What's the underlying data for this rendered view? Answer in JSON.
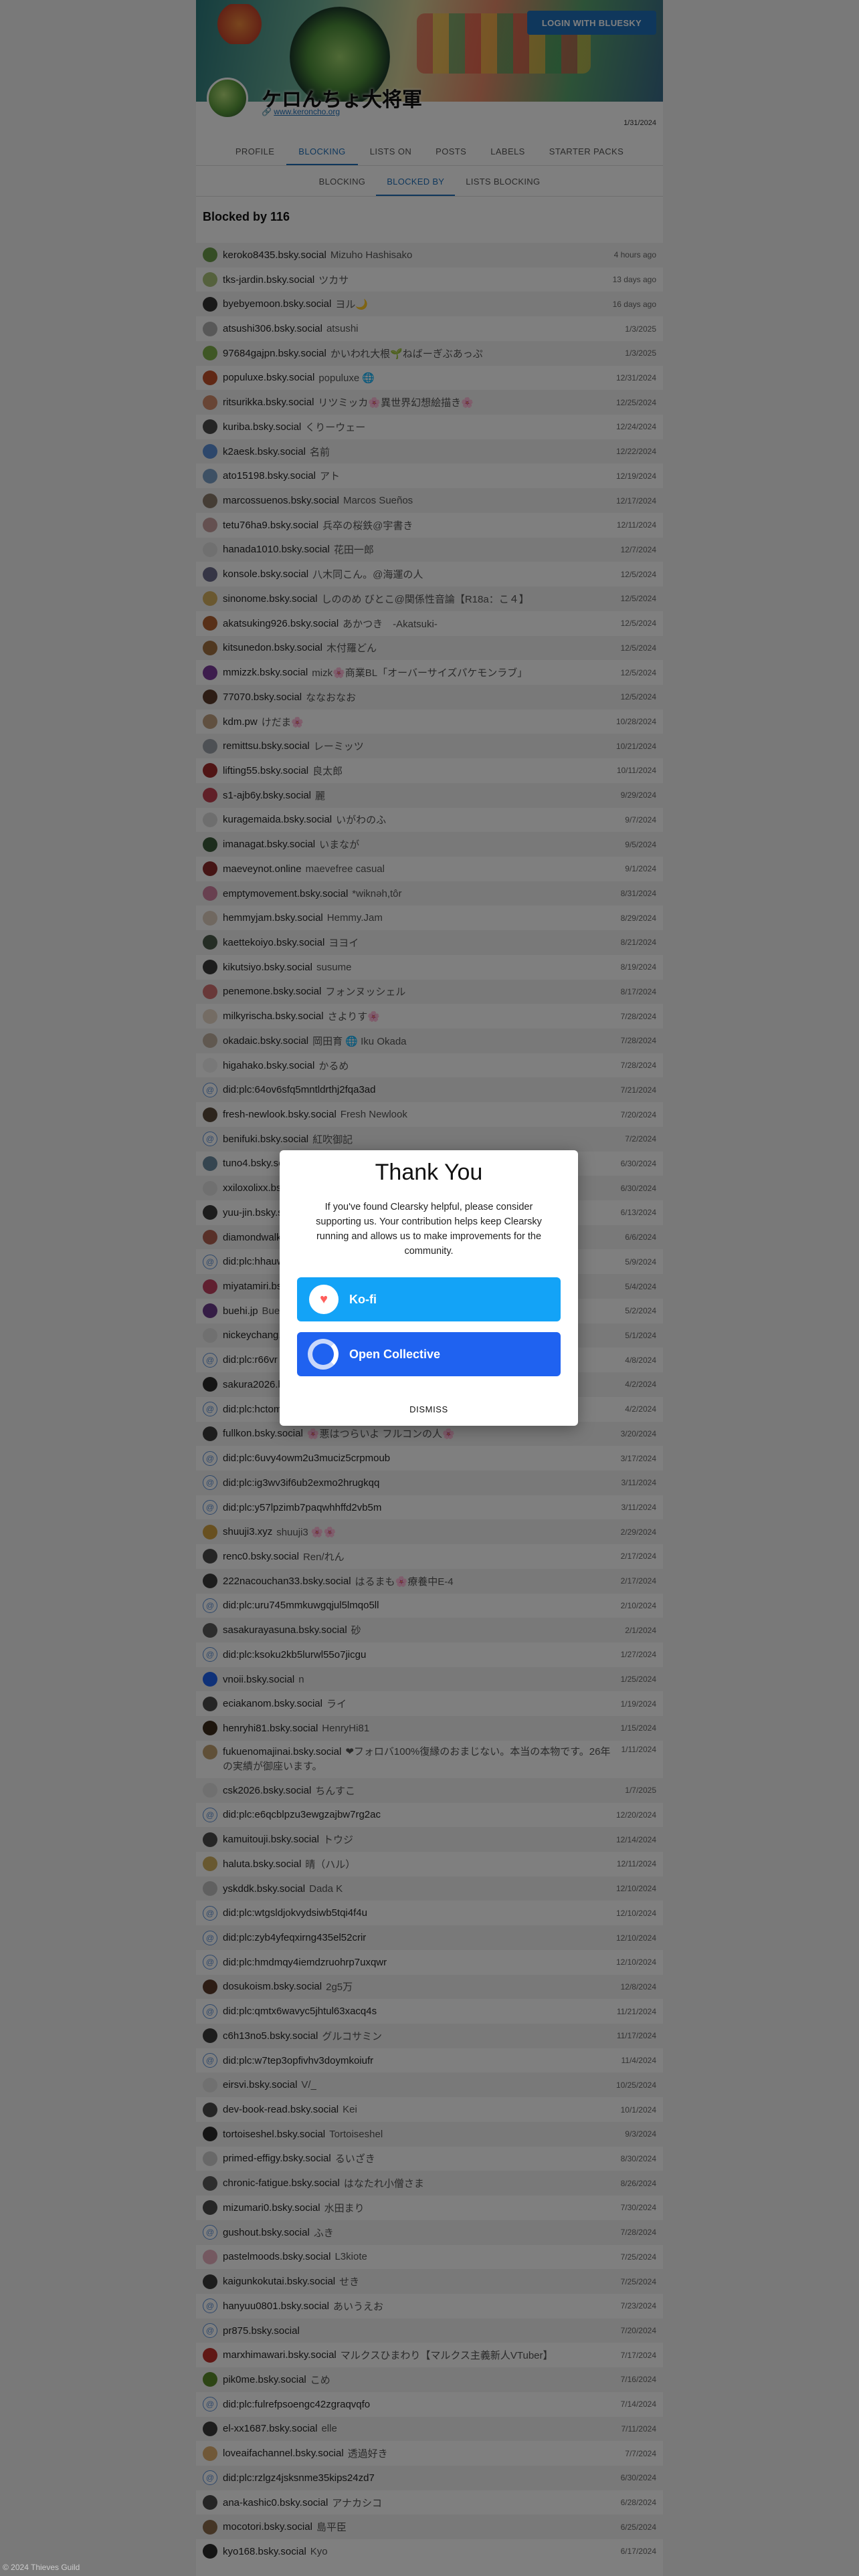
{
  "header": {
    "login_label": "LOGIN WITH BLUESKY",
    "display_name": "ケロんちょ大将軍",
    "link_prefix": "🔗",
    "link": "www.keroncho.org",
    "joined_date": "1/31/2024"
  },
  "tabs": [
    "PROFILE",
    "BLOCKING",
    "LISTS ON",
    "POSTS",
    "LABELS",
    "STARTER PACKS"
  ],
  "active_tab": "BLOCKING",
  "subtabs": [
    "BLOCKING",
    "BLOCKED BY",
    "LISTS BLOCKING"
  ],
  "active_subtab": "BLOCKED BY",
  "list_title": "Blocked by 116",
  "rows": [
    {
      "handle": "keroko8435.bsky.social",
      "name": "Mizuho Hashisako",
      "date": "4 hours ago",
      "color": "#6a9a4a"
    },
    {
      "handle": "tks-jardin.bsky.social",
      "name": "ツカサ",
      "date": "13 days ago",
      "color": "#aac27a"
    },
    {
      "handle": "byebyemoon.bsky.social",
      "name": "ヨル🌙",
      "date": "16 days ago",
      "color": "#333333"
    },
    {
      "handle": "atsushi306.bsky.social",
      "name": "atsushi",
      "date": "1/3/2025",
      "color": "#b0b0b0"
    },
    {
      "handle": "97684gajpn.bsky.social",
      "name": "かいわれ大根🌱ねばーぎぶあっぷ",
      "date": "1/3/2025",
      "color": "#7fae4a"
    },
    {
      "handle": "populuxe.bsky.social",
      "name": "populuxe 🌐",
      "date": "12/31/2024",
      "color": "#c0502a"
    },
    {
      "handle": "ritsurikka.bsky.social",
      "name": "リツミッカ🌸異世界幻想絵描き🌸",
      "date": "12/25/2024",
      "color": "#d08a6a"
    },
    {
      "handle": "kuriba.bsky.social",
      "name": "くりーウェー",
      "date": "12/24/2024",
      "color": "#4a4a4a"
    },
    {
      "handle": "k2aesk.bsky.social",
      "name": "名前",
      "date": "12/22/2024",
      "color": "#5a8fd6"
    },
    {
      "handle": "ato15198.bsky.social",
      "name": "アト",
      "date": "12/19/2024",
      "color": "#7aa0c8"
    },
    {
      "handle": "marcossuenos.bsky.social",
      "name": "Marcos Sueños",
      "date": "12/17/2024",
      "color": "#8a7a6a"
    },
    {
      "handle": "tetu76ha9.bsky.social",
      "name": "兵卒の桜鉄@宇書き",
      "date": "12/11/2024",
      "color": "#c8a0a0"
    },
    {
      "handle": "hanada1010.bsky.social",
      "name": "花田一郎",
      "date": "12/7/2024",
      "color": "#e0e0e0"
    },
    {
      "handle": "konsole.bsky.social",
      "name": "八木同こん。@海運の人",
      "date": "12/5/2024",
      "color": "#6a6a8a"
    },
    {
      "handle": "sinonome.bsky.social",
      "name": "しののめ びとこ@関係性音論【R18a：こ４】",
      "date": "12/5/2024",
      "color": "#d4b060"
    },
    {
      "handle": "akatsuking926.bsky.social",
      "name": "あかつき　-Akatsuki-",
      "date": "12/5/2024",
      "color": "#b06030"
    },
    {
      "handle": "kitsunedon.bsky.social",
      "name": "木付羅どん",
      "date": "12/5/2024",
      "color": "#a07040"
    },
    {
      "handle": "mmizzk.bsky.social",
      "name": "mizk🌸商業BL「オーバーサイズパケモンラブ」",
      "date": "12/5/2024",
      "color": "#7a3a9a"
    },
    {
      "handle": "77070.bsky.social",
      "name": "ななおなお",
      "date": "12/5/2024",
      "color": "#5a3a2a"
    },
    {
      "handle": "kdm.pw",
      "name": "けだま🌸",
      "date": "10/28/2024",
      "color": "#c0a080"
    },
    {
      "handle": "remittsu.bsky.social",
      "name": "レーミッツ",
      "date": "10/21/2024",
      "color": "#9aa0a8"
    },
    {
      "handle": "lifting55.bsky.social",
      "name": "良太郎",
      "date": "10/11/2024",
      "color": "#a02a2a"
    },
    {
      "handle": "s1-ajb6y.bsky.social",
      "name": "麗",
      "date": "9/29/2024",
      "color": "#c04050"
    },
    {
      "handle": "kuragemaida.bsky.social",
      "name": "いがわのふ",
      "date": "9/7/2024",
      "color": "#dddddd"
    },
    {
      "handle": "imanagat.bsky.social",
      "name": "いまなが",
      "date": "9/5/2024",
      "color": "#3a5a3a"
    },
    {
      "handle": "maeveynot.online",
      "name": "maevefree casual",
      "date": "9/1/2024",
      "color": "#8a2a2a"
    },
    {
      "handle": "emptymovement.bsky.social",
      "name": "*wiknəh,tôr",
      "date": "8/31/2024",
      "color": "#d080a0"
    },
    {
      "handle": "hemmyjam.bsky.social",
      "name": "Hemmy.Jam",
      "date": "8/29/2024",
      "color": "#e0d0c0"
    },
    {
      "handle": "kaettekoiyo.bsky.social",
      "name": "ヨヨイ",
      "date": "8/21/2024",
      "color": "#4a5a4a"
    },
    {
      "handle": "kikutsiyo.bsky.social",
      "name": "susume",
      "date": "8/19/2024",
      "color": "#3a3a3a"
    },
    {
      "handle": "penemone.bsky.social",
      "name": "フォンヌッシェル",
      "date": "8/17/2024",
      "color": "#d07070"
    },
    {
      "handle": "milkyrischa.bsky.social",
      "name": "さよりす🌸",
      "date": "7/28/2024",
      "color": "#e8d8c8"
    },
    {
      "handle": "okadaic.bsky.social",
      "name": "岡田育 🌐 Iku Okada",
      "date": "7/28/2024",
      "color": "#c0b0a0"
    },
    {
      "handle": "higahako.bsky.social",
      "name": "かるめ",
      "date": "7/28/2024",
      "color": "#f0f0f0"
    },
    {
      "handle": "did:plc:64ov6sfq5mntldrthj2fqa3ad",
      "name": "",
      "date": "7/21/2024",
      "color": "did"
    },
    {
      "handle": "fresh-newlook.bsky.social",
      "name": "Fresh Newlook",
      "date": "7/20/2024",
      "color": "#5a4a3a"
    },
    {
      "handle": "benifuki.bsky.social",
      "name": "紅吹御記",
      "date": "7/2/2024",
      "color": "did"
    },
    {
      "handle": "tuno4.bsky.social",
      "name": "",
      "date": "6/30/2024",
      "color": "#6a8aa0"
    },
    {
      "handle": "xxiloxolixx.bsky.social",
      "name": "",
      "date": "6/30/2024",
      "color": "#e0e0e0"
    },
    {
      "handle": "yuu-jin.bsky.social",
      "name": "",
      "date": "6/13/2024",
      "color": "#3a3a3a"
    },
    {
      "handle": "diamondwalker.bsky.social",
      "name": "",
      "date": "6/6/2024",
      "color": "#b06050"
    },
    {
      "handle": "did:plc:hhauw",
      "name": "",
      "date": "5/9/2024",
      "color": "did"
    },
    {
      "handle": "miyatamiri.bsky.social",
      "name": "",
      "date": "5/4/2024",
      "color": "#c04060"
    },
    {
      "handle": "buehi.jp",
      "name": "Buehi",
      "date": "5/2/2024",
      "color": "#6a3a8a"
    },
    {
      "handle": "nickeychang.bsky.social",
      "name": "",
      "date": "5/1/2024",
      "color": "#e0e0e0"
    },
    {
      "handle": "did:plc:r66vr",
      "name": "",
      "date": "4/8/2024",
      "color": "did"
    },
    {
      "handle": "sakura2026.bsky.social",
      "name": "",
      "date": "4/2/2024",
      "color": "#2a2a2a"
    },
    {
      "handle": "did:plc:hctom",
      "name": "",
      "date": "4/2/2024",
      "color": "did"
    },
    {
      "handle": "fullkon.bsky.social",
      "name": "🌸悪はつらいよ フルコンの人🌸",
      "date": "3/20/2024",
      "color": "#3a3a3a"
    },
    {
      "handle": "did:plc:6uvy4owm2u3muciz5crpmoub",
      "name": "",
      "date": "3/17/2024",
      "color": "did"
    },
    {
      "handle": "did:plc:ig3wv3if6ub2exmo2hrugkqq",
      "name": "",
      "date": "3/11/2024",
      "color": "did"
    },
    {
      "handle": "did:plc:y57lpzimb7paqwhhffd2vb5m",
      "name": "",
      "date": "3/11/2024",
      "color": "did"
    },
    {
      "handle": "shuuji3.xyz",
      "name": "shuuji3 🌸🌸",
      "date": "2/29/2024",
      "color": "#d0a040"
    },
    {
      "handle": "renc0.bsky.social",
      "name": "Ren/れん",
      "date": "2/17/2024",
      "color": "#4a4a4a"
    },
    {
      "handle": "222nacouchan33.bsky.social",
      "name": "はるまも🌸療養中E-4",
      "date": "2/17/2024",
      "color": "#3a3a3a"
    },
    {
      "handle": "did:plc:uru745mmkuwgqjul5lmqo5ll",
      "name": "",
      "date": "2/10/2024",
      "color": "did"
    },
    {
      "handle": "sasakurayasuna.bsky.social",
      "name": "砂",
      "date": "2/1/2024",
      "color": "#5a5a5a"
    },
    {
      "handle": "did:plc:ksoku2kb5lurwl55o7jicgu",
      "name": "",
      "date": "1/27/2024",
      "color": "did"
    },
    {
      "handle": "vnoii.bsky.social",
      "name": "n",
      "date": "1/25/2024",
      "color": "#1f62f0"
    },
    {
      "handle": "eciakanom.bsky.social",
      "name": "ライ",
      "date": "1/19/2024",
      "color": "#4a4a4a"
    },
    {
      "handle": "henryhi81.bsky.social",
      "name": "HenryHi81",
      "date": "1/15/2024",
      "color": "#3a2a1a"
    },
    {
      "handle": "fukuenomajinai.bsky.social",
      "name": "❤フォロバ100%復縁のおまじない。本当の本物です。26年の実績が御座います。",
      "date": "1/11/2024",
      "color": "#c0a070",
      "tall": true
    },
    {
      "handle": "csk2026.bsky.social",
      "name": "ちんすこ",
      "date": "1/7/2025",
      "color": "#e0e0e0"
    },
    {
      "handle": "did:plc:e6qcblpzu3ewgzajbw7rg2ac",
      "name": "",
      "date": "12/20/2024",
      "color": "did"
    },
    {
      "handle": "kamuitouji.bsky.social",
      "name": "トウジ",
      "date": "12/14/2024",
      "color": "#4a4a4a"
    },
    {
      "handle": "haluta.bsky.social",
      "name": "晴（ハル）",
      "date": "12/11/2024",
      "color": "#d0b060"
    },
    {
      "handle": "yskddk.bsky.social",
      "name": "Dada K",
      "date": "12/10/2024",
      "color": "#c0c0c0"
    },
    {
      "handle": "did:plc:wtgsldjokvydsiwb5tqi4f4u",
      "name": "",
      "date": "12/10/2024",
      "color": "did"
    },
    {
      "handle": "did:plc:zyb4yfeqxirng435el52crir",
      "name": "",
      "date": "12/10/2024",
      "color": "did"
    },
    {
      "handle": "did:plc:hmdmqy4iemdzruohrp7uxqwr",
      "name": "",
      "date": "12/10/2024",
      "color": "did"
    },
    {
      "handle": "dosukoism.bsky.social",
      "name": "2g5万",
      "date": "12/8/2024",
      "color": "#5a3a2a"
    },
    {
      "handle": "did:plc:qmtx6wavyc5jhtul63xacq4s",
      "name": "",
      "date": "11/21/2024",
      "color": "did"
    },
    {
      "handle": "c6h13no5.bsky.social",
      "name": "グルコサミン",
      "date": "11/17/2024",
      "color": "#3a3a3a"
    },
    {
      "handle": "did:plc:w7tep3opfivhv3doymkoiufr",
      "name": "",
      "date": "11/4/2024",
      "color": "did"
    },
    {
      "handle": "eirsvi.bsky.social",
      "name": "V/_",
      "date": "10/25/2024",
      "color": "#e0e0e0"
    },
    {
      "handle": "dev-book-read.bsky.social",
      "name": "Kei",
      "date": "10/1/2024",
      "color": "#4a4a4a"
    },
    {
      "handle": "tortoiseshel.bsky.social",
      "name": "Tortoiseshel",
      "date": "9/3/2024",
      "color": "#2a2a2a"
    },
    {
      "handle": "primed-effigy.bsky.social",
      "name": "るいざき",
      "date": "8/30/2024",
      "color": "#d0d0d0"
    },
    {
      "handle": "chronic-fatigue.bsky.social",
      "name": "はなたれ小僧さま",
      "date": "8/26/2024",
      "color": "#5a5a5a"
    },
    {
      "handle": "mizumari0.bsky.social",
      "name": "水田まり",
      "date": "7/30/2024",
      "color": "#4a4a4a"
    },
    {
      "handle": "gushout.bsky.social",
      "name": "ふき",
      "date": "7/28/2024",
      "color": "did"
    },
    {
      "handle": "pastelmoods.bsky.social",
      "name": "L3kiote",
      "date": "7/25/2024",
      "color": "#e8b0c0"
    },
    {
      "handle": "kaigunkokutai.bsky.social",
      "name": "せき",
      "date": "7/25/2024",
      "color": "#3a3a3a"
    },
    {
      "handle": "hanyuu0801.bsky.social",
      "name": "あいうえお",
      "date": "7/23/2024",
      "color": "did"
    },
    {
      "handle": "pr875.bsky.social",
      "name": "",
      "date": "7/20/2024",
      "color": "did"
    },
    {
      "handle": "marxhimawari.bsky.social",
      "name": "マルクスひまわり【マルクス主義新人VTuber】",
      "date": "7/17/2024",
      "color": "#c0302a"
    },
    {
      "handle": "pik0me.bsky.social",
      "name": "こめ",
      "date": "7/16/2024",
      "color": "#5a8a2a"
    },
    {
      "handle": "did:plc:fulrefpsoengc42zgraqvqfo",
      "name": "",
      "date": "7/14/2024",
      "color": "did"
    },
    {
      "handle": "el-xx1687.bsky.social",
      "name": "elle",
      "date": "7/11/2024",
      "color": "#3a3a3a"
    },
    {
      "handle": "loveaifachannel.bsky.social",
      "name": "透過好き",
      "date": "7/7/2024",
      "color": "#e0b070"
    },
    {
      "handle": "did:plc:rzlgz4jsksnme35kips24zd7",
      "name": "",
      "date": "6/30/2024",
      "color": "did"
    },
    {
      "handle": "ana-kashic0.bsky.social",
      "name": "アナカシコ",
      "date": "6/28/2024",
      "color": "#4a4a4a"
    },
    {
      "handle": "mocotori.bsky.social",
      "name": "島平臣",
      "date": "6/25/2024",
      "color": "#8a6a4a"
    },
    {
      "handle": "kyo168.bsky.social",
      "name": "Kyo",
      "date": "6/17/2024",
      "color": "#2a2a2a"
    }
  ],
  "modal": {
    "title": "Thank You",
    "text": "If you've found Clearsky helpful, please consider supporting us. Your contribution helps keep Clearsky running and allows us to make improvements for the community.",
    "kofi_label": "Ko-fi",
    "kofi_icon": "coffee-cup-heart-icon",
    "oc_label": "Open Collective",
    "oc_icon": "open-collective-ring-icon",
    "dismiss_label": "DISMISS",
    "kofi_color": "#13a3f7",
    "oc_color": "#1f62f0"
  },
  "footer": "© 2024 Thieves Guild"
}
